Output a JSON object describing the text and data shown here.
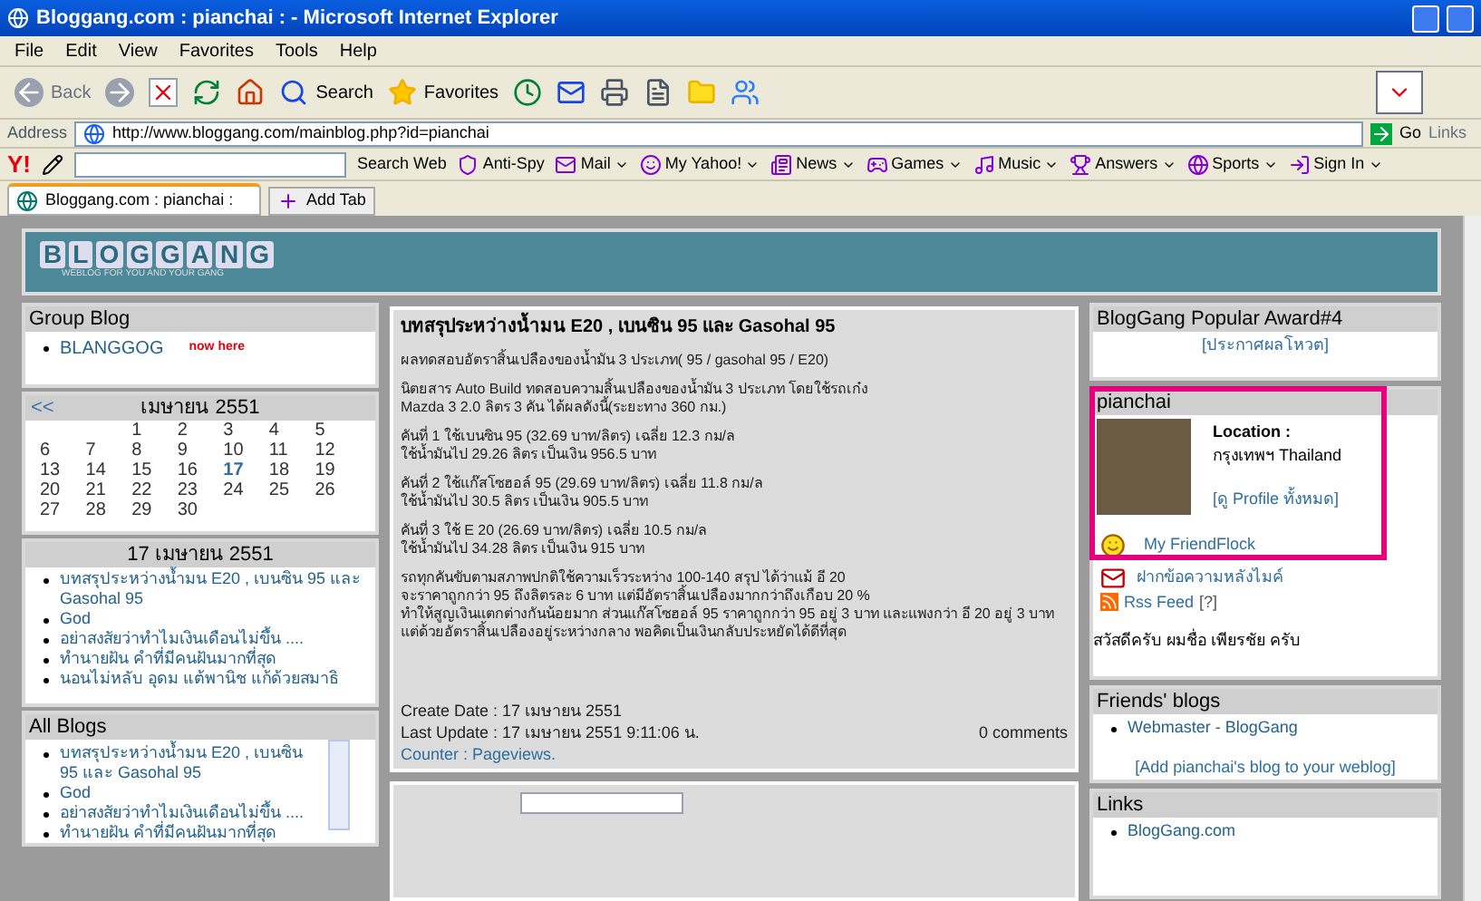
{
  "window": {
    "title": "Bloggang.com : pianchai : - Microsoft Internet Explorer"
  },
  "menu": [
    "File",
    "Edit",
    "View",
    "Favorites",
    "Tools",
    "Help"
  ],
  "toolbar": {
    "back": "Back",
    "search": "Search",
    "favorites": "Favorites"
  },
  "address": {
    "label": "Address",
    "url": "http://www.bloggang.com/mainblog.php?id=pianchai",
    "go": "Go",
    "links": "Links"
  },
  "yahoo_bar": {
    "logo": "Y!",
    "search_button": "Search Web",
    "items": [
      {
        "kind": "plain",
        "label": "Anti-Spy"
      },
      {
        "kind": "menu",
        "label": "Mail"
      },
      {
        "kind": "menu",
        "label": "My Yahoo!"
      },
      {
        "kind": "menu",
        "label": "News"
      },
      {
        "kind": "menu",
        "label": "Games"
      },
      {
        "kind": "menu",
        "label": "Music"
      },
      {
        "kind": "menu",
        "label": "Answers"
      },
      {
        "kind": "menu",
        "label": "Sports"
      },
      {
        "kind": "menu",
        "label": "Sign In"
      }
    ]
  },
  "tabs": [
    {
      "label": "Bloggang.com : pianchai :",
      "selected": true
    }
  ],
  "add_tab": "Add Tab",
  "banner": {
    "logo_letters": [
      "B",
      "L",
      "O",
      "G",
      "G",
      "A",
      "N",
      "G"
    ],
    "tagline": "WEBLOG FOR YOU AND YOUR GANG"
  },
  "group_blog": {
    "title": "Group Blog",
    "items": [
      {
        "label": "BLANGGOG",
        "badge": "now here"
      }
    ]
  },
  "calendar": {
    "prev": "<<",
    "month": "เมษายน 2551",
    "weeks": [
      [
        {
          "day": "1",
          "today": false
        },
        {
          "day": "2",
          "today": false
        },
        {
          "day": "3",
          "today": false
        },
        {
          "day": "4",
          "today": false
        },
        {
          "day": "5",
          "today": false
        }
      ],
      [
        {
          "day": "6",
          "today": false
        },
        {
          "day": "7",
          "today": false
        },
        {
          "day": "8",
          "today": false
        },
        {
          "day": "9",
          "today": false
        },
        {
          "day": "10",
          "today": false
        },
        {
          "day": "11",
          "today": false
        },
        {
          "day": "12",
          "today": false
        }
      ],
      [
        {
          "day": "13",
          "today": false
        },
        {
          "day": "14",
          "today": false
        },
        {
          "day": "15",
          "today": false
        },
        {
          "day": "16",
          "today": false
        },
        {
          "day": "17",
          "today": true
        },
        {
          "day": "18",
          "today": false
        },
        {
          "day": "19",
          "today": false
        }
      ],
      [
        {
          "day": "20",
          "today": false
        },
        {
          "day": "21",
          "today": false
        },
        {
          "day": "22",
          "today": false
        },
        {
          "day": "23",
          "today": false
        },
        {
          "day": "24",
          "today": false
        },
        {
          "day": "25",
          "today": false
        },
        {
          "day": "26",
          "today": false
        }
      ],
      [
        {
          "day": "27",
          "today": false
        },
        {
          "day": "28",
          "today": false
        },
        {
          "day": "29",
          "today": false
        },
        {
          "day": "30",
          "today": false
        }
      ]
    ]
  },
  "day_posts": {
    "title": "17 เมษายน 2551",
    "items": [
      "บทสรุประหว่างน้ำมน E20 , เบนซิน 95 และ Gasohal 95",
      "God",
      "อย่าสงสัยว่าทำไมเงินเดือนไม่ขึ้น ....",
      "ทำนายฝัน คำที่มีคนฝันมากที่สุด",
      "นอนไม่หลับ อุดม แต้พานิช แก้ด้วยสมาธิ"
    ]
  },
  "all_blogs": {
    "title": "All Blogs",
    "items": [
      "บทสรุประหว่างน้ำมน E20 , เบนซิน 95 และ Gasohal 95",
      "God",
      "อย่าสงสัยว่าทำไมเงินเดือนไม่ขึ้น ....",
      "ทำนายฝัน คำที่มีคนฝันมากที่สุด"
    ]
  },
  "post": {
    "title": "บทสรุประหว่างน้ำมน E20 , เบนซิน 95 และ Gasohal 95",
    "paragraphs": [
      [
        "ผลทดสอบอัตราสิ้นเปลืองของน้ำมัน 3 ประเภท( 95 / gasohal 95 / E20)"
      ],
      [
        "นิตยสาร Auto Build ทดสอบความสิ้นเปลืองของน้ำมัน 3 ประเภท โดยใช้รถเก๋ง",
        "Mazda 3 2.0 ลิตร 3 คัน ได้ผลดังนี้(ระยะทาง 360 กม.)"
      ],
      [
        "คันที่ 1 ใช้เบนซิน 95 (32.69 บาท/ลิตร) เฉลี่ย 12.3 กม/ล",
        "ใช้น้ำมันไป 29.26 ลิตร เป็นเงิน 956.5 บาท"
      ],
      [
        "คันที่ 2 ใช้แก๊สโซฮอล์ 95 (29.69 บาท/ลิตร) เฉลี่ย 11.8 กม/ล",
        "ใช้น้ำมันไป 30.5 ลิตร เป็นเงิน 905.5 บาท"
      ],
      [
        "คันที่ 3 ใช้ E 20 (26.69 บาท/ลิตร) เฉลี่ย 10.5 กม/ล",
        "ใช้น้ำมันไป 34.28 ลิตร เป็นเงิน 915 บาท"
      ],
      [
        "รถทุกคันขับตามสภาพปกติใช้ความเร็วระหว่าง 100-140 สรุป ได้ว่าแม้ อี 20",
        "จะราคาถูกกว่า 95 ถึงลิตรละ 6 บาท แต่มีอัตราสิ้นเปลืองมากกว่าถึงเกือบ 20 %",
        "ทำให้สูญเงินแตกต่างกันน้อยมาก ส่วนแก๊สโซฮอล์ 95 ราคาถูกกว่า 95 อยู่ 3 บาท และแพงกว่า อี 20 อยู่ 3 บาท",
        "แต่ด้วยอัตราสิ้นเปลืองอยู่ระหว่างกลาง พอคิดเป็นเงินกลับประหยัดได้ดีที่สุด"
      ]
    ],
    "create_date": "Create Date : 17 เมษายน 2551",
    "last_update": "Last Update : 17 เมษายน 2551 9:11:06 น.",
    "comments": "0 comments",
    "counter": "Counter : Pageviews."
  },
  "award": {
    "title": "BlogGang Popular Award#4",
    "link": "[ประกาศผลโหวต]"
  },
  "profile": {
    "name": "pianchai",
    "location_label": "Location :",
    "location": "กรุงเทพฯ Thailand",
    "profile_link": "[ดู Profile ทั้งหมด]",
    "friendflock": "My FriendFlock",
    "message": "ฝากข้อความหลังไมค์",
    "rss": "Rss Feed",
    "rss_help": "[?]",
    "greeting": "สวัสดีครับ ผมชื่อ เพียรชัย ครับ"
  },
  "friends": {
    "title": "Friends' blogs",
    "items": [
      "Webmaster - BlogGang"
    ],
    "add_link": "[Add pianchai's blog to your weblog]"
  },
  "links": {
    "title": "Links",
    "items": [
      "BlogGang.com"
    ]
  }
}
